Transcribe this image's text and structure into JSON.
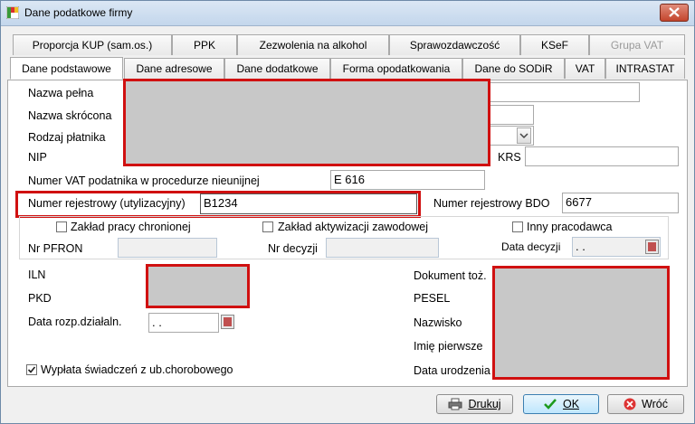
{
  "window": {
    "title": "Dane podatkowe firmy"
  },
  "tabs_row1": [
    {
      "label": "Proporcja KUP (sam.os.)",
      "disabled": false
    },
    {
      "label": "PPK",
      "disabled": false
    },
    {
      "label": "Zezwolenia na alkohol",
      "disabled": false
    },
    {
      "label": "Sprawozdawczość",
      "disabled": false
    },
    {
      "label": "KSeF",
      "disabled": false
    },
    {
      "label": "Grupa VAT",
      "disabled": true
    }
  ],
  "tabs_row2": [
    {
      "label": "Dane podstawowe",
      "active": true
    },
    {
      "label": "Dane adresowe"
    },
    {
      "label": "Dane dodatkowe"
    },
    {
      "label": "Forma opodatkowania"
    },
    {
      "label": "Dane do SODiR"
    },
    {
      "label": "VAT"
    },
    {
      "label": "INTRASTAT"
    }
  ],
  "form": {
    "nazwa_pelna_label": "Nazwa pełna",
    "nazwa_skrocona_label": "Nazwa skrócona",
    "rodzaj_platnika_label": "Rodzaj płatnika",
    "nip_label": "NIP",
    "krs_label": "KRS",
    "numer_vat_label": "Numer VAT podatnika w procedurze nieunijnej",
    "numer_vat_value": "E 616",
    "numer_rej_util_label": "Numer rejestrowy (utylizacyjny)",
    "numer_rej_util_value": "B1234",
    "numer_rej_bdo_label": "Numer rejestrowy  BDO",
    "numer_rej_bdo_value": "6677",
    "zaklad_chroniony_label": "Zakład pracy chronionej",
    "zaklad_aktywizacji_label": "Zakład  aktywizacji zawodowej",
    "inny_pracodawca_label": "Inny pracodawca",
    "nr_pfron_label": "Nr PFRON",
    "nr_decyzji_label": "Nr decyzji",
    "data_decyzji_label": "Data decyzji",
    "data_decyzji_value": ". .",
    "iln_label": "ILN",
    "pkd_label": "PKD",
    "data_rozp_label": "Data rozp.działaln.",
    "data_rozp_value": ". .",
    "wyplata_label": "Wypłata świadczeń z ub.chorobowego",
    "wyplata_checked": true,
    "dokument_label": "Dokument toż.",
    "pesel_label": "PESEL",
    "nazwisko_label": "Nazwisko",
    "imie_label": "Imię pierwsze",
    "data_ur_label": "Data urodzenia"
  },
  "buttons": {
    "print": "Drukuj",
    "ok": "OK",
    "back": "Wróć"
  }
}
